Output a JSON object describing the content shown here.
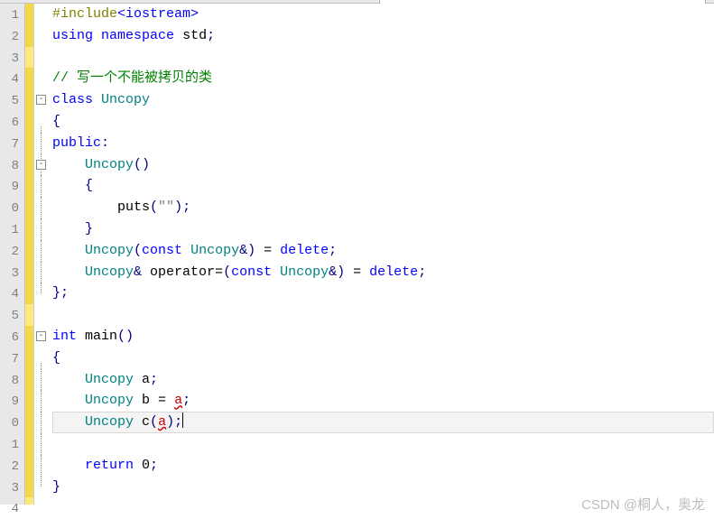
{
  "watermark": "CSDN @桐人，奥龙",
  "gutter": [
    "1",
    "2",
    "3",
    "4",
    "5",
    "6",
    "7",
    "8",
    "9",
    "0",
    "1",
    "2",
    "3",
    "4",
    "5",
    "6",
    "7",
    "8",
    "9",
    "0",
    "1",
    "2",
    "3",
    "4"
  ],
  "fold": {
    "class_box": "-",
    "ctor_box": "-",
    "main_box": "-"
  },
  "tokens": {
    "l1": {
      "pp": "#include",
      "hdr": "<iostream>"
    },
    "l2": {
      "using": "using",
      "ns": "namespace",
      "std": "std",
      "semi": ";"
    },
    "l4": {
      "com": "// 写一个不能被拷贝的类"
    },
    "l5": {
      "cls": "class",
      "name": "Uncopy"
    },
    "l6": {
      "brace": "{"
    },
    "l7": {
      "pub": "public",
      "colon": ":"
    },
    "l8": {
      "name": "Uncopy",
      "paren": "()"
    },
    "l9": {
      "brace": "{"
    },
    "l10": {
      "puts": "puts",
      "lp": "(",
      "str": "\"\"",
      "rp": ")",
      "semi": ";"
    },
    "l11": {
      "brace": "}"
    },
    "l12": {
      "name": "Uncopy",
      "lp": "(",
      "const": "const",
      "ty": "Uncopy",
      "amp": "&",
      "rp": ")",
      "eq": " = ",
      "del": "delete",
      "semi": ";"
    },
    "l13": {
      "ty1": "Uncopy",
      "amp1": "&",
      "op": " operator=",
      "lp": "(",
      "const": "const",
      "ty2": "Uncopy",
      "amp2": "&",
      "rp": ")",
      "eq": " = ",
      "del": "delete",
      "semi": ";"
    },
    "l14": {
      "brace": "};"
    },
    "l16": {
      "int": "int",
      "main": "main",
      "paren": "()"
    },
    "l17": {
      "brace": "{"
    },
    "l18": {
      "ty": "Uncopy",
      "var": " a",
      "semi": ";"
    },
    "l19": {
      "ty": "Uncopy",
      "var": " b",
      "eq": " = ",
      "a": "a",
      "semi": ";"
    },
    "l20": {
      "ty": "Uncopy",
      "var": " c",
      "lp": "(",
      "a": "a",
      "rp": ")",
      "semi": ";"
    },
    "l22": {
      "ret": "return",
      "zero": " 0",
      "semi": ";"
    },
    "l23": {
      "brace": "}"
    }
  }
}
